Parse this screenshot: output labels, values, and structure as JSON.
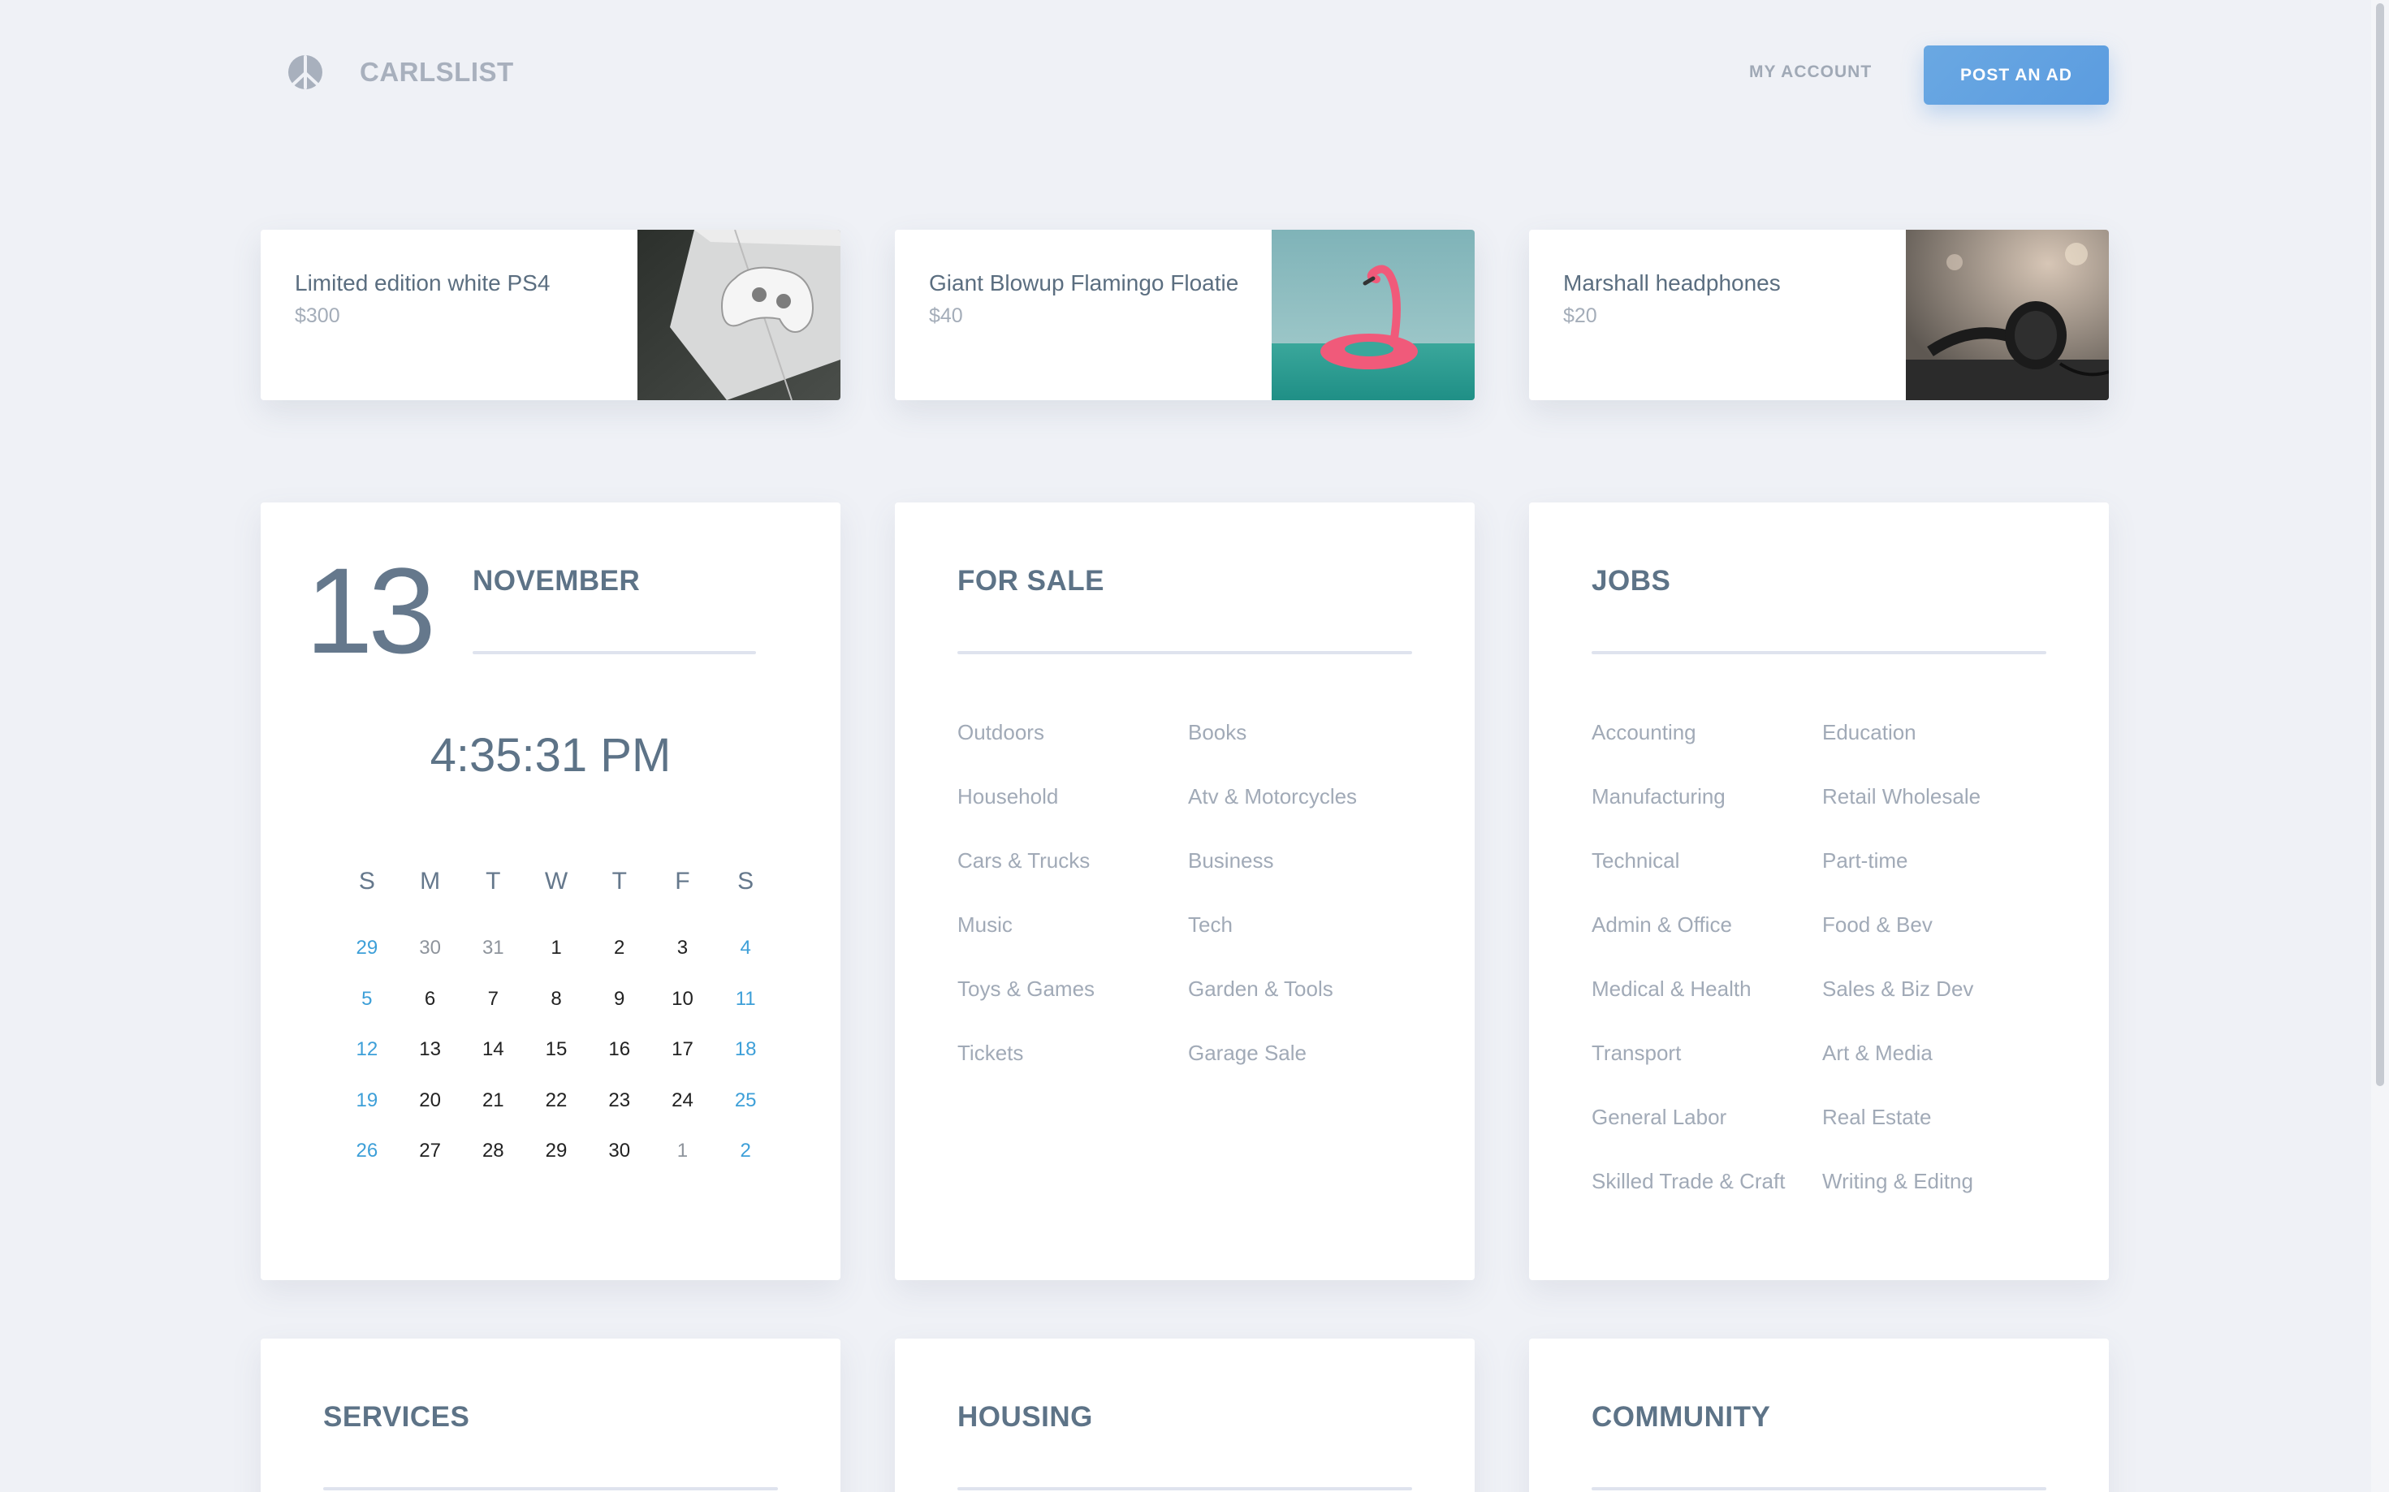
{
  "header": {
    "brand": "CARLSLIST",
    "my_account": "MY ACCOUNT",
    "post_ad": "POST AN AD"
  },
  "featured": [
    {
      "title": "Limited edition white PS4",
      "price": "$300",
      "image": "ps4-controller-photo"
    },
    {
      "title": "Giant Blowup Flamingo Floatie",
      "price": "$40",
      "image": "flamingo-floatie-photo"
    },
    {
      "title": "Marshall headphones",
      "price": "$20",
      "image": "marshall-headphones-photo"
    }
  ],
  "calendar": {
    "day": "13",
    "month": "NOVEMBER",
    "time": "4:35:31 PM",
    "weekdays": [
      "S",
      "M",
      "T",
      "W",
      "T",
      "F",
      "S"
    ],
    "weeks": [
      [
        "29",
        "30",
        "31",
        "1",
        "2",
        "3",
        "4"
      ],
      [
        "5",
        "6",
        "7",
        "8",
        "9",
        "10",
        "11"
      ],
      [
        "12",
        "13",
        "14",
        "15",
        "16",
        "17",
        "18"
      ],
      [
        "19",
        "20",
        "21",
        "22",
        "23",
        "24",
        "25"
      ],
      [
        "26",
        "27",
        "28",
        "29",
        "30",
        "1",
        "2"
      ]
    ],
    "weekend_color": "#3d9fd8"
  },
  "for_sale": {
    "heading": "FOR SALE",
    "col1": [
      "Outdoors",
      "Household",
      "Cars & Trucks",
      "Music",
      "Toys & Games",
      "Tickets"
    ],
    "col2": [
      "Books",
      "Atv & Motorcycles",
      "Business",
      "Tech",
      "Garden & Tools",
      "Garage Sale"
    ]
  },
  "jobs": {
    "heading": "JOBS",
    "col1": [
      "Accounting",
      "Manufacturing",
      "Technical",
      "Admin & Office",
      "Medical & Health",
      "Transport",
      "General Labor",
      "Skilled Trade & Craft"
    ],
    "col2": [
      "Education",
      "Retail Wholesale",
      "Part-time",
      "Food & Bev",
      "Sales & Biz Dev",
      "Art & Media",
      "Real Estate",
      "Writing & Editng"
    ]
  },
  "services": {
    "heading": "SERVICES"
  },
  "housing": {
    "heading": "HOUSING"
  },
  "community": {
    "heading": "COMMUNITY"
  },
  "colors": {
    "accent": "#5b9ce0",
    "background": "#eff1f6",
    "heading": "#5d7387"
  }
}
